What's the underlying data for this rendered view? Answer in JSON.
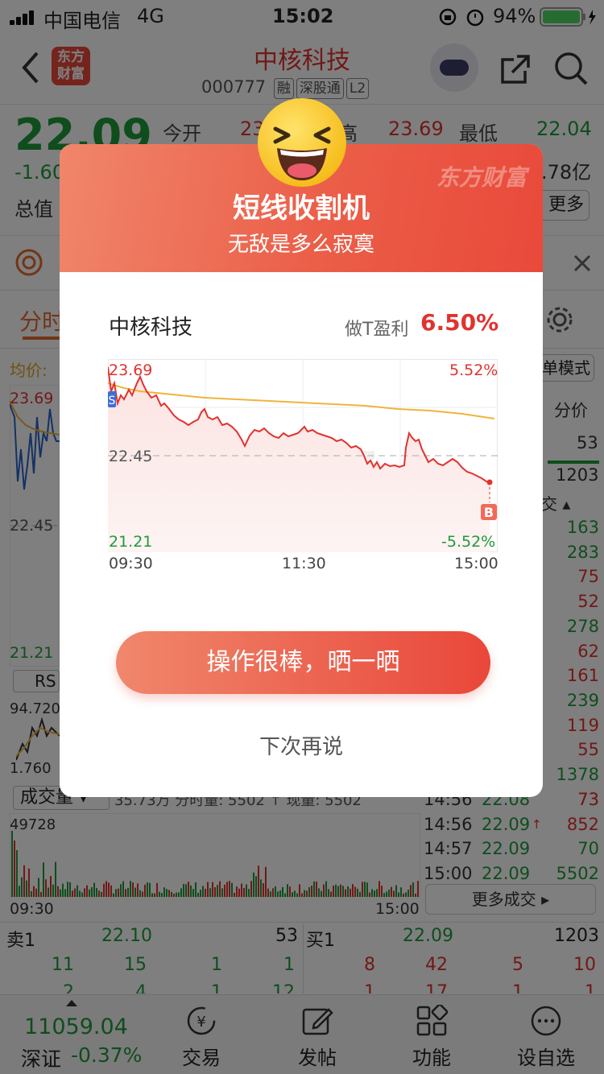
{
  "status_bar": {
    "carrier": "中国电信",
    "network": "4G",
    "time": "15:02",
    "battery": "94%"
  },
  "header": {
    "stock_name": "中核科技",
    "stock_code": "000777",
    "tags": [
      "融",
      "深股通",
      "L2"
    ],
    "logo_text": "东方财富"
  },
  "quote": {
    "price": "22.09",
    "change": "-1.60",
    "open_label": "今开",
    "open_value": "23",
    "high_label": "高",
    "high_value": "23.69",
    "low_label": "最低",
    "low_value": "22.04",
    "total_label": "总值",
    "amount_suffix": ".78亿",
    "more_label": "更多"
  },
  "tabs": {
    "intraday": "分时",
    "avg_price": "均价:",
    "mode": "单模式"
  },
  "background_chart": {
    "high": "23.69",
    "mid": "22.45",
    "low": "21.21",
    "rsi": "RS",
    "ind_high": "94.720",
    "ind_low": "1.760",
    "vol_label": "成交量",
    "vol_info": "35.73万 分时量: 5502 ↑ 现量: 5502",
    "vol_max": "49728",
    "time_start": "09:30",
    "time_end": "15:00"
  },
  "trade_list": {
    "header_a": "分价",
    "val1": "53",
    "val2": "1203",
    "sort_label": "交",
    "volumes": [
      "163",
      "283",
      "75",
      "52",
      "278",
      "62",
      "161",
      "239",
      "119",
      "55",
      "1378",
      "73"
    ],
    "rows": [
      {
        "time": "14:56",
        "price": "22.08",
        "vol": "73"
      },
      {
        "time": "14:56",
        "price": "22.09",
        "vol": "852",
        "arrow": "↑"
      },
      {
        "time": "14:57",
        "price": "22.09",
        "vol": "70"
      },
      {
        "time": "15:00",
        "price": "22.09",
        "vol": "5502"
      }
    ],
    "more": "更多成交"
  },
  "order_book": {
    "sell_label": "卖1",
    "sell_price": "22.10",
    "sell_vol": "53",
    "buy_label": "买1",
    "buy_price": "22.09",
    "buy_vol": "1203",
    "sell_row": [
      "11",
      "15",
      "1",
      "1"
    ],
    "sell_row2": [
      "2",
      "4",
      "1",
      "12"
    ],
    "buy_row": [
      "8",
      "42",
      "5",
      "10"
    ],
    "buy_row2": [
      "1",
      "17",
      "1",
      "1"
    ]
  },
  "tab_bar": {
    "index_value": "11059.04",
    "index_name": "深证",
    "index_change": "-0.37%",
    "items": [
      "交易",
      "发帖",
      "功能",
      "设自选"
    ]
  },
  "dialog": {
    "watermark": "东方财富",
    "title": "短线收割机",
    "subtitle": "无敌是多么寂寞",
    "stock_name": "中核科技",
    "profit_label": "做T盈利",
    "profit_value": "6.50%",
    "chart": {
      "high": "23.69",
      "mid": "22.45",
      "low": "21.21",
      "pct_high": "5.52%",
      "pct_low": "-5.52%",
      "times": [
        "09:30",
        "11:30",
        "15:00"
      ],
      "sell_marker": "S",
      "buy_marker": "B"
    },
    "share_button": "操作很棒，晒一晒",
    "later_button": "下次再说"
  },
  "colors": {
    "up": "#e0332f",
    "down": "#1f9a3a",
    "accent": "#e9493a",
    "avg_line": "#f0b43c"
  }
}
